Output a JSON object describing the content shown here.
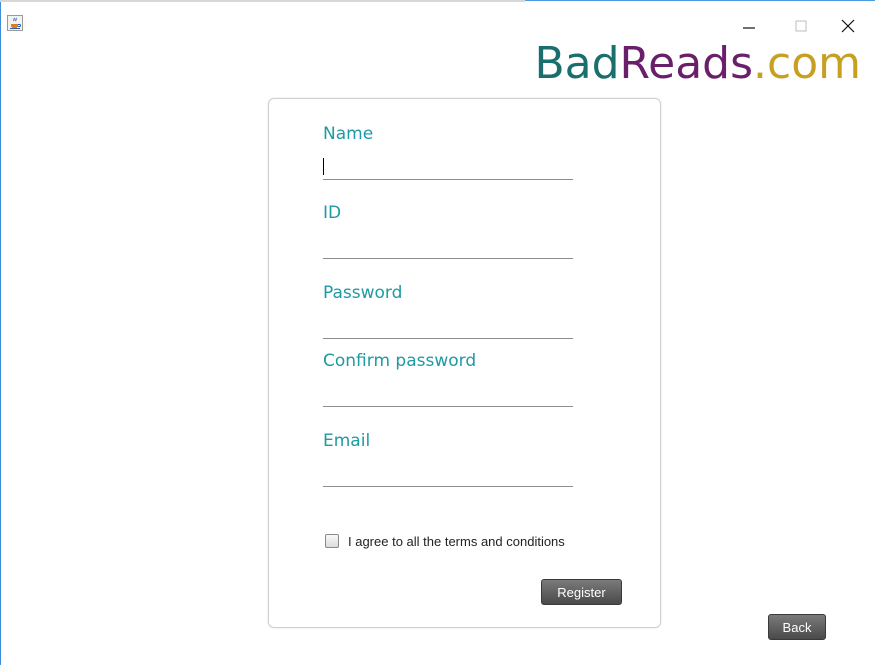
{
  "window": {
    "icon": "java-cup-icon",
    "controls": [
      "minimize-icon",
      "maximize-icon",
      "close-icon"
    ]
  },
  "brand": {
    "part1": "Bad",
    "part2": "Reads",
    "part3": ".com",
    "colors": {
      "part1": "#1b6e6e",
      "part2": "#6a1f6a",
      "part3": "#c8a021"
    }
  },
  "form": {
    "fields": [
      {
        "label": "Name",
        "value": ""
      },
      {
        "label": "ID",
        "value": ""
      },
      {
        "label": "Password",
        "value": ""
      },
      {
        "label": "Confirm password",
        "value": ""
      },
      {
        "label": "Email",
        "value": ""
      }
    ],
    "terms_label": "I agree to all the terms and conditions",
    "terms_checked": false,
    "register_label": "Register"
  },
  "back_label": "Back",
  "accent_color": "#1e9aa3"
}
